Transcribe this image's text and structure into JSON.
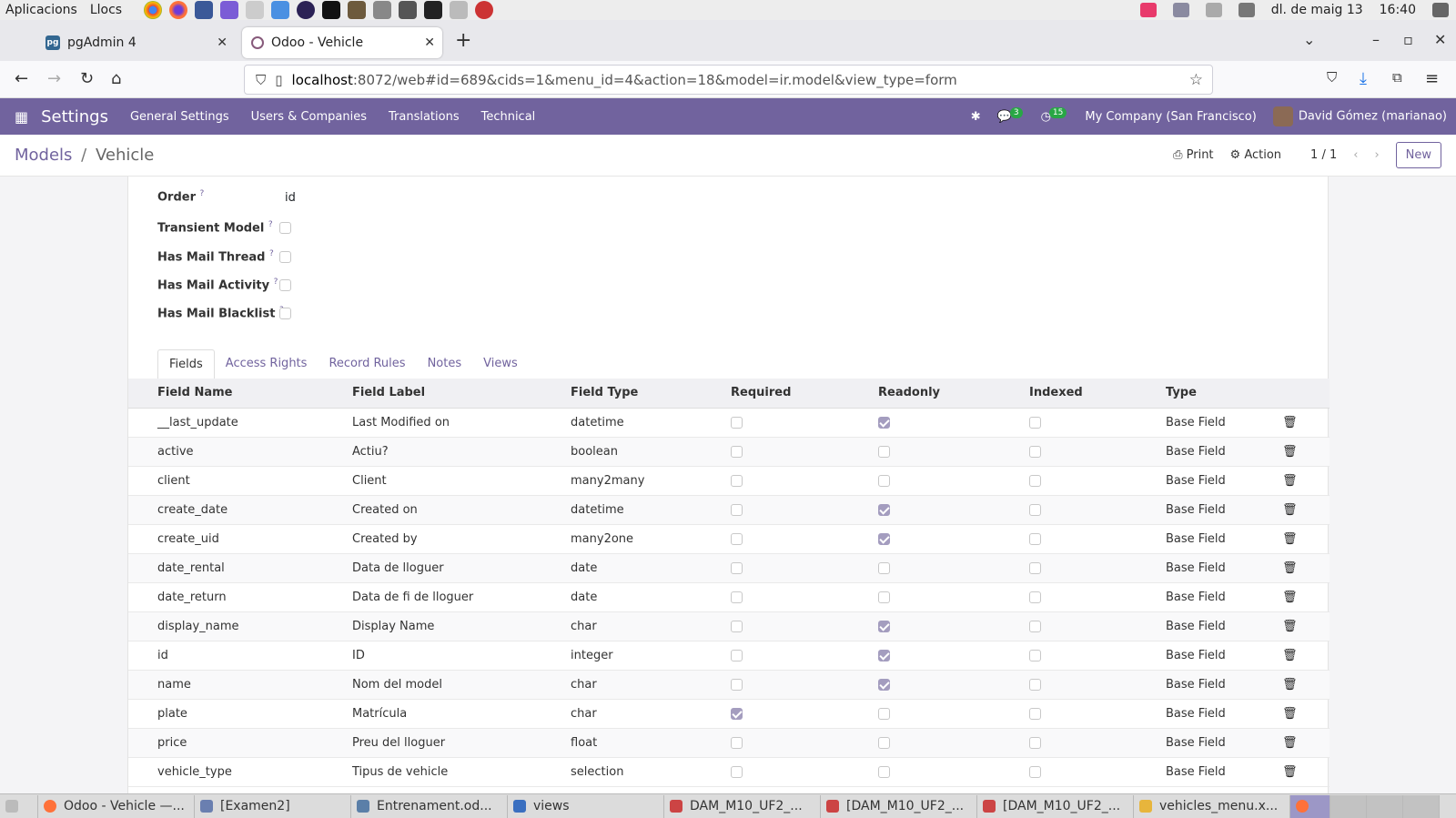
{
  "os": {
    "menu": [
      "Aplicacions",
      "Llocs"
    ],
    "datetime": "dl. de maig 13",
    "time": "16:40"
  },
  "browser": {
    "tabs": [
      {
        "label": "pgAdmin 4",
        "icon": "pgadmin-icon"
      },
      {
        "label": "Odoo - Vehicle",
        "icon": "odoo-icon"
      }
    ],
    "url_host": "localhost",
    "url_rest": ":8072/web#id=689&cids=1&menu_id=4&action=18&model=ir.model&view_type=form"
  },
  "odoo_nav": {
    "brand": "Settings",
    "menu": [
      "General Settings",
      "Users & Companies",
      "Translations",
      "Technical"
    ],
    "messages_count": "3",
    "activities_count": "15",
    "company": "My Company (San Francisco)",
    "user": "David Gómez (marianao)"
  },
  "control": {
    "breadcrumb_parent": "Models",
    "breadcrumb_current": "Vehicle",
    "print_label": "Print",
    "action_label": "Action",
    "pager": "1 / 1",
    "new_label": "New"
  },
  "form": {
    "order_label": "Order",
    "order_value": "id",
    "transient_label": "Transient Model",
    "mail_thread_label": "Has Mail Thread",
    "mail_activity_label": "Has Mail Activity",
    "mail_blacklist_label": "Has Mail Blacklist"
  },
  "notebook": {
    "tabs": [
      "Fields",
      "Access Rights",
      "Record Rules",
      "Notes",
      "Views"
    ]
  },
  "fields_table": {
    "columns": [
      "Field Name",
      "Field Label",
      "Field Type",
      "Required",
      "Readonly",
      "Indexed",
      "Type"
    ],
    "rows": [
      {
        "name": "__last_update",
        "label": "Last Modified on",
        "type": "datetime",
        "required": false,
        "readonly": true,
        "indexed": false,
        "kind": "Base Field"
      },
      {
        "name": "active",
        "label": "Actiu?",
        "type": "boolean",
        "required": false,
        "readonly": false,
        "indexed": false,
        "kind": "Base Field"
      },
      {
        "name": "client",
        "label": "Client",
        "type": "many2many",
        "required": false,
        "readonly": false,
        "indexed": false,
        "kind": "Base Field"
      },
      {
        "name": "create_date",
        "label": "Created on",
        "type": "datetime",
        "required": false,
        "readonly": true,
        "indexed": false,
        "kind": "Base Field"
      },
      {
        "name": "create_uid",
        "label": "Created by",
        "type": "many2one",
        "required": false,
        "readonly": true,
        "indexed": false,
        "kind": "Base Field"
      },
      {
        "name": "date_rental",
        "label": "Data de lloguer",
        "type": "date",
        "required": false,
        "readonly": false,
        "indexed": false,
        "kind": "Base Field"
      },
      {
        "name": "date_return",
        "label": "Data de fi de lloguer",
        "type": "date",
        "required": false,
        "readonly": false,
        "indexed": false,
        "kind": "Base Field"
      },
      {
        "name": "display_name",
        "label": "Display Name",
        "type": "char",
        "required": false,
        "readonly": true,
        "indexed": false,
        "kind": "Base Field"
      },
      {
        "name": "id",
        "label": "ID",
        "type": "integer",
        "required": false,
        "readonly": true,
        "indexed": false,
        "kind": "Base Field"
      },
      {
        "name": "name",
        "label": "Nom del model",
        "type": "char",
        "required": false,
        "readonly": true,
        "indexed": false,
        "kind": "Base Field"
      },
      {
        "name": "plate",
        "label": "Matrícula",
        "type": "char",
        "required": true,
        "readonly": false,
        "indexed": false,
        "kind": "Base Field"
      },
      {
        "name": "price",
        "label": "Preu del lloguer",
        "type": "float",
        "required": false,
        "readonly": false,
        "indexed": false,
        "kind": "Base Field"
      },
      {
        "name": "vehicle_type",
        "label": "Tipus de vehicle",
        "type": "selection",
        "required": false,
        "readonly": false,
        "indexed": false,
        "kind": "Base Field"
      }
    ]
  },
  "taskbar": {
    "items": [
      "Odoo - Vehicle —...",
      "[Examen2]",
      "Entrenament.od...",
      "views",
      "DAM_M10_UF2_...",
      "[DAM_M10_UF2_...",
      "[DAM_M10_UF2_...",
      "vehicles_menu.x..."
    ]
  }
}
